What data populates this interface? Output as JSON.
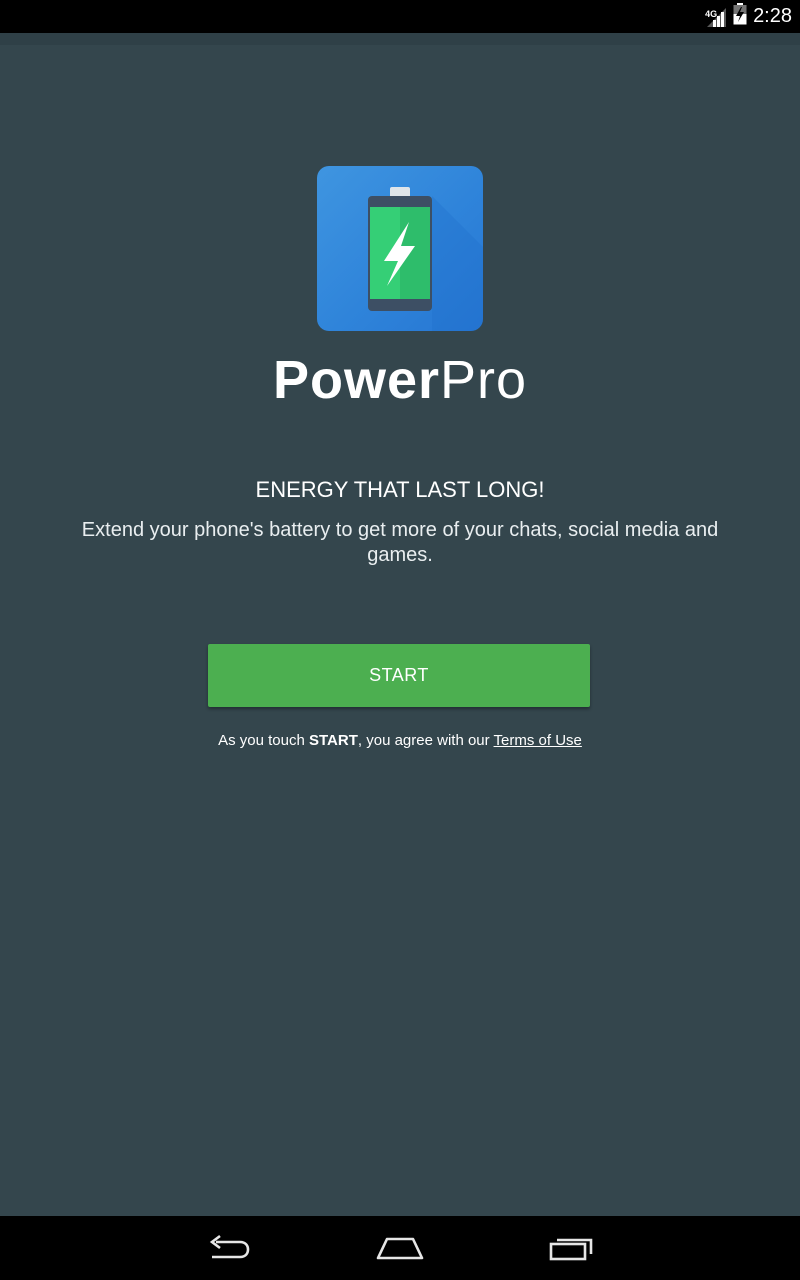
{
  "status_bar": {
    "network": "4G",
    "time": "2:28",
    "icons": [
      "signal-icon",
      "battery-charging-icon"
    ]
  },
  "app": {
    "icon": "battery-bolt-icon",
    "name_bold": "Power",
    "name_light": "Pro"
  },
  "onboarding": {
    "headline": "ENERGY THAT LAST LONG!",
    "description": "Extend your phone's battery to get more of your chats, social media and games."
  },
  "start_button": {
    "label": "START"
  },
  "terms": {
    "prefix": "As you touch ",
    "emphasis": "START",
    "middle": ", you agree with our ",
    "link_label": "Terms of Use"
  },
  "nav_bar": {
    "icons": [
      "back-icon",
      "home-icon",
      "recents-icon"
    ]
  },
  "colors": {
    "background": "#34464d",
    "button": "#4caf50",
    "icon_tile": "#2f84da",
    "battery_green": "#2ecc71"
  }
}
